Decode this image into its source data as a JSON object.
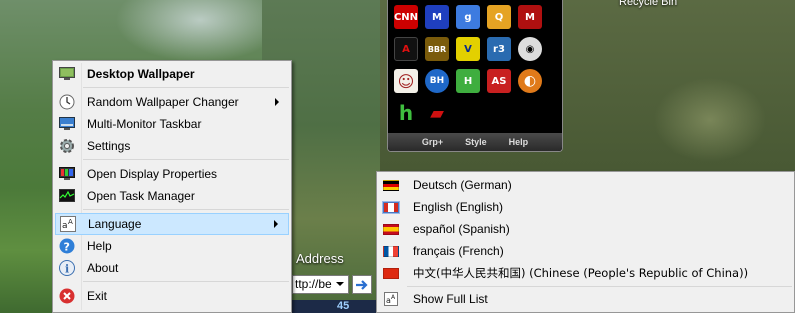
{
  "desktop": {
    "recycle_bin_label": "Recycle Bin",
    "address_label": "Address",
    "address_value": "ttp://be",
    "tray_number": "45"
  },
  "launcher": {
    "apps": [
      {
        "name": "cnn",
        "label": "CNN",
        "bg": "#cc0000"
      },
      {
        "name": "m",
        "label": "M",
        "bg": "#1f3fbf"
      },
      {
        "name": "google",
        "label": "g",
        "bg": "#3d7be0"
      },
      {
        "name": "search",
        "label": "Q",
        "bg": "#e5a323"
      },
      {
        "name": "m-red",
        "label": "M",
        "bg": "#b01010"
      },
      {
        "name": "avira",
        "label": "A",
        "bg": "#111111"
      },
      {
        "name": "bbr",
        "label": "BBR",
        "bg": "#7a5b0b"
      },
      {
        "name": "v",
        "label": "V",
        "bg": "#e3d000"
      },
      {
        "name": "rss",
        "label": "r3",
        "bg": "#2a6bb0"
      },
      {
        "name": "gear",
        "label": "◉",
        "bg": "#222222"
      },
      {
        "name": "cartoon",
        "label": "☺",
        "bg": "#6a4a2a"
      },
      {
        "name": "bh",
        "label": "BH",
        "bg": "#1f68c8"
      },
      {
        "name": "h-green",
        "label": "H",
        "bg": "#3fae3f"
      },
      {
        "name": "as",
        "label": "AS",
        "bg": "#c82020"
      },
      {
        "name": "swirl",
        "label": "◐",
        "bg": "#e07a1a"
      },
      {
        "name": "h-small",
        "label": "h",
        "bg": "#000000"
      },
      {
        "name": "red-shape",
        "label": "▰",
        "bg": "#000000"
      }
    ],
    "bar": [
      "Grp+",
      "Style",
      "Help"
    ]
  },
  "menu": {
    "items": [
      {
        "label": "Desktop Wallpaper",
        "icon": "wallpaper-icon"
      },
      {
        "label": "Random Wallpaper Changer",
        "icon": "clock-icon"
      },
      {
        "label": "Multi-Monitor Taskbar",
        "icon": "monitor-icon"
      },
      {
        "label": "Settings",
        "icon": "gear-icon"
      },
      {
        "label": "Open Display Properties",
        "icon": "display-icon"
      },
      {
        "label": "Open Task Manager",
        "icon": "task-manager-icon"
      },
      {
        "label": "Language",
        "icon": "language-icon"
      },
      {
        "label": "Help",
        "icon": "help-icon"
      },
      {
        "label": "About",
        "icon": "info-icon"
      },
      {
        "label": "Exit",
        "icon": "exit-icon"
      }
    ]
  },
  "language_menu": {
    "items": [
      {
        "label": "Deutsch (German)",
        "flag": "flag-germany-icon"
      },
      {
        "label": "English (English)",
        "flag": "flag-canada-icon"
      },
      {
        "label": "español (Spanish)",
        "flag": "flag-spain-icon"
      },
      {
        "label": "français (French)",
        "flag": "flag-france-icon"
      },
      {
        "label": "中文(中华人民共和国) (Chinese (People's Republic of China))",
        "flag": "flag-china-icon"
      },
      {
        "label": "Show Full List",
        "flag": "language-icon"
      }
    ]
  },
  "colors": {
    "highlight": "#cce8ff",
    "highlight_border": "#99d1ff",
    "menu_bg": "#f0f0f0"
  }
}
